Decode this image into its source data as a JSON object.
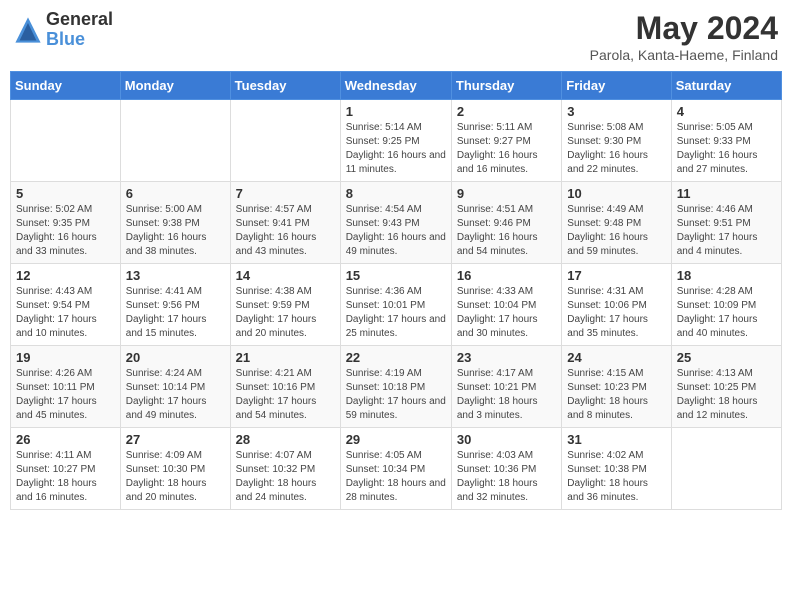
{
  "logo": {
    "general": "General",
    "blue": "Blue"
  },
  "header": {
    "month": "May 2024",
    "location": "Parola, Kanta-Haeme, Finland"
  },
  "weekdays": [
    "Sunday",
    "Monday",
    "Tuesday",
    "Wednesday",
    "Thursday",
    "Friday",
    "Saturday"
  ],
  "weeks": [
    [
      {
        "day": "",
        "info": ""
      },
      {
        "day": "",
        "info": ""
      },
      {
        "day": "",
        "info": ""
      },
      {
        "day": "1",
        "info": "Sunrise: 5:14 AM\nSunset: 9:25 PM\nDaylight: 16 hours and 11 minutes."
      },
      {
        "day": "2",
        "info": "Sunrise: 5:11 AM\nSunset: 9:27 PM\nDaylight: 16 hours and 16 minutes."
      },
      {
        "day": "3",
        "info": "Sunrise: 5:08 AM\nSunset: 9:30 PM\nDaylight: 16 hours and 22 minutes."
      },
      {
        "day": "4",
        "info": "Sunrise: 5:05 AM\nSunset: 9:33 PM\nDaylight: 16 hours and 27 minutes."
      }
    ],
    [
      {
        "day": "5",
        "info": "Sunrise: 5:02 AM\nSunset: 9:35 PM\nDaylight: 16 hours and 33 minutes."
      },
      {
        "day": "6",
        "info": "Sunrise: 5:00 AM\nSunset: 9:38 PM\nDaylight: 16 hours and 38 minutes."
      },
      {
        "day": "7",
        "info": "Sunrise: 4:57 AM\nSunset: 9:41 PM\nDaylight: 16 hours and 43 minutes."
      },
      {
        "day": "8",
        "info": "Sunrise: 4:54 AM\nSunset: 9:43 PM\nDaylight: 16 hours and 49 minutes."
      },
      {
        "day": "9",
        "info": "Sunrise: 4:51 AM\nSunset: 9:46 PM\nDaylight: 16 hours and 54 minutes."
      },
      {
        "day": "10",
        "info": "Sunrise: 4:49 AM\nSunset: 9:48 PM\nDaylight: 16 hours and 59 minutes."
      },
      {
        "day": "11",
        "info": "Sunrise: 4:46 AM\nSunset: 9:51 PM\nDaylight: 17 hours and 4 minutes."
      }
    ],
    [
      {
        "day": "12",
        "info": "Sunrise: 4:43 AM\nSunset: 9:54 PM\nDaylight: 17 hours and 10 minutes."
      },
      {
        "day": "13",
        "info": "Sunrise: 4:41 AM\nSunset: 9:56 PM\nDaylight: 17 hours and 15 minutes."
      },
      {
        "day": "14",
        "info": "Sunrise: 4:38 AM\nSunset: 9:59 PM\nDaylight: 17 hours and 20 minutes."
      },
      {
        "day": "15",
        "info": "Sunrise: 4:36 AM\nSunset: 10:01 PM\nDaylight: 17 hours and 25 minutes."
      },
      {
        "day": "16",
        "info": "Sunrise: 4:33 AM\nSunset: 10:04 PM\nDaylight: 17 hours and 30 minutes."
      },
      {
        "day": "17",
        "info": "Sunrise: 4:31 AM\nSunset: 10:06 PM\nDaylight: 17 hours and 35 minutes."
      },
      {
        "day": "18",
        "info": "Sunrise: 4:28 AM\nSunset: 10:09 PM\nDaylight: 17 hours and 40 minutes."
      }
    ],
    [
      {
        "day": "19",
        "info": "Sunrise: 4:26 AM\nSunset: 10:11 PM\nDaylight: 17 hours and 45 minutes."
      },
      {
        "day": "20",
        "info": "Sunrise: 4:24 AM\nSunset: 10:14 PM\nDaylight: 17 hours and 49 minutes."
      },
      {
        "day": "21",
        "info": "Sunrise: 4:21 AM\nSunset: 10:16 PM\nDaylight: 17 hours and 54 minutes."
      },
      {
        "day": "22",
        "info": "Sunrise: 4:19 AM\nSunset: 10:18 PM\nDaylight: 17 hours and 59 minutes."
      },
      {
        "day": "23",
        "info": "Sunrise: 4:17 AM\nSunset: 10:21 PM\nDaylight: 18 hours and 3 minutes."
      },
      {
        "day": "24",
        "info": "Sunrise: 4:15 AM\nSunset: 10:23 PM\nDaylight: 18 hours and 8 minutes."
      },
      {
        "day": "25",
        "info": "Sunrise: 4:13 AM\nSunset: 10:25 PM\nDaylight: 18 hours and 12 minutes."
      }
    ],
    [
      {
        "day": "26",
        "info": "Sunrise: 4:11 AM\nSunset: 10:27 PM\nDaylight: 18 hours and 16 minutes."
      },
      {
        "day": "27",
        "info": "Sunrise: 4:09 AM\nSunset: 10:30 PM\nDaylight: 18 hours and 20 minutes."
      },
      {
        "day": "28",
        "info": "Sunrise: 4:07 AM\nSunset: 10:32 PM\nDaylight: 18 hours and 24 minutes."
      },
      {
        "day": "29",
        "info": "Sunrise: 4:05 AM\nSunset: 10:34 PM\nDaylight: 18 hours and 28 minutes."
      },
      {
        "day": "30",
        "info": "Sunrise: 4:03 AM\nSunset: 10:36 PM\nDaylight: 18 hours and 32 minutes."
      },
      {
        "day": "31",
        "info": "Sunrise: 4:02 AM\nSunset: 10:38 PM\nDaylight: 18 hours and 36 minutes."
      },
      {
        "day": "",
        "info": ""
      }
    ]
  ]
}
